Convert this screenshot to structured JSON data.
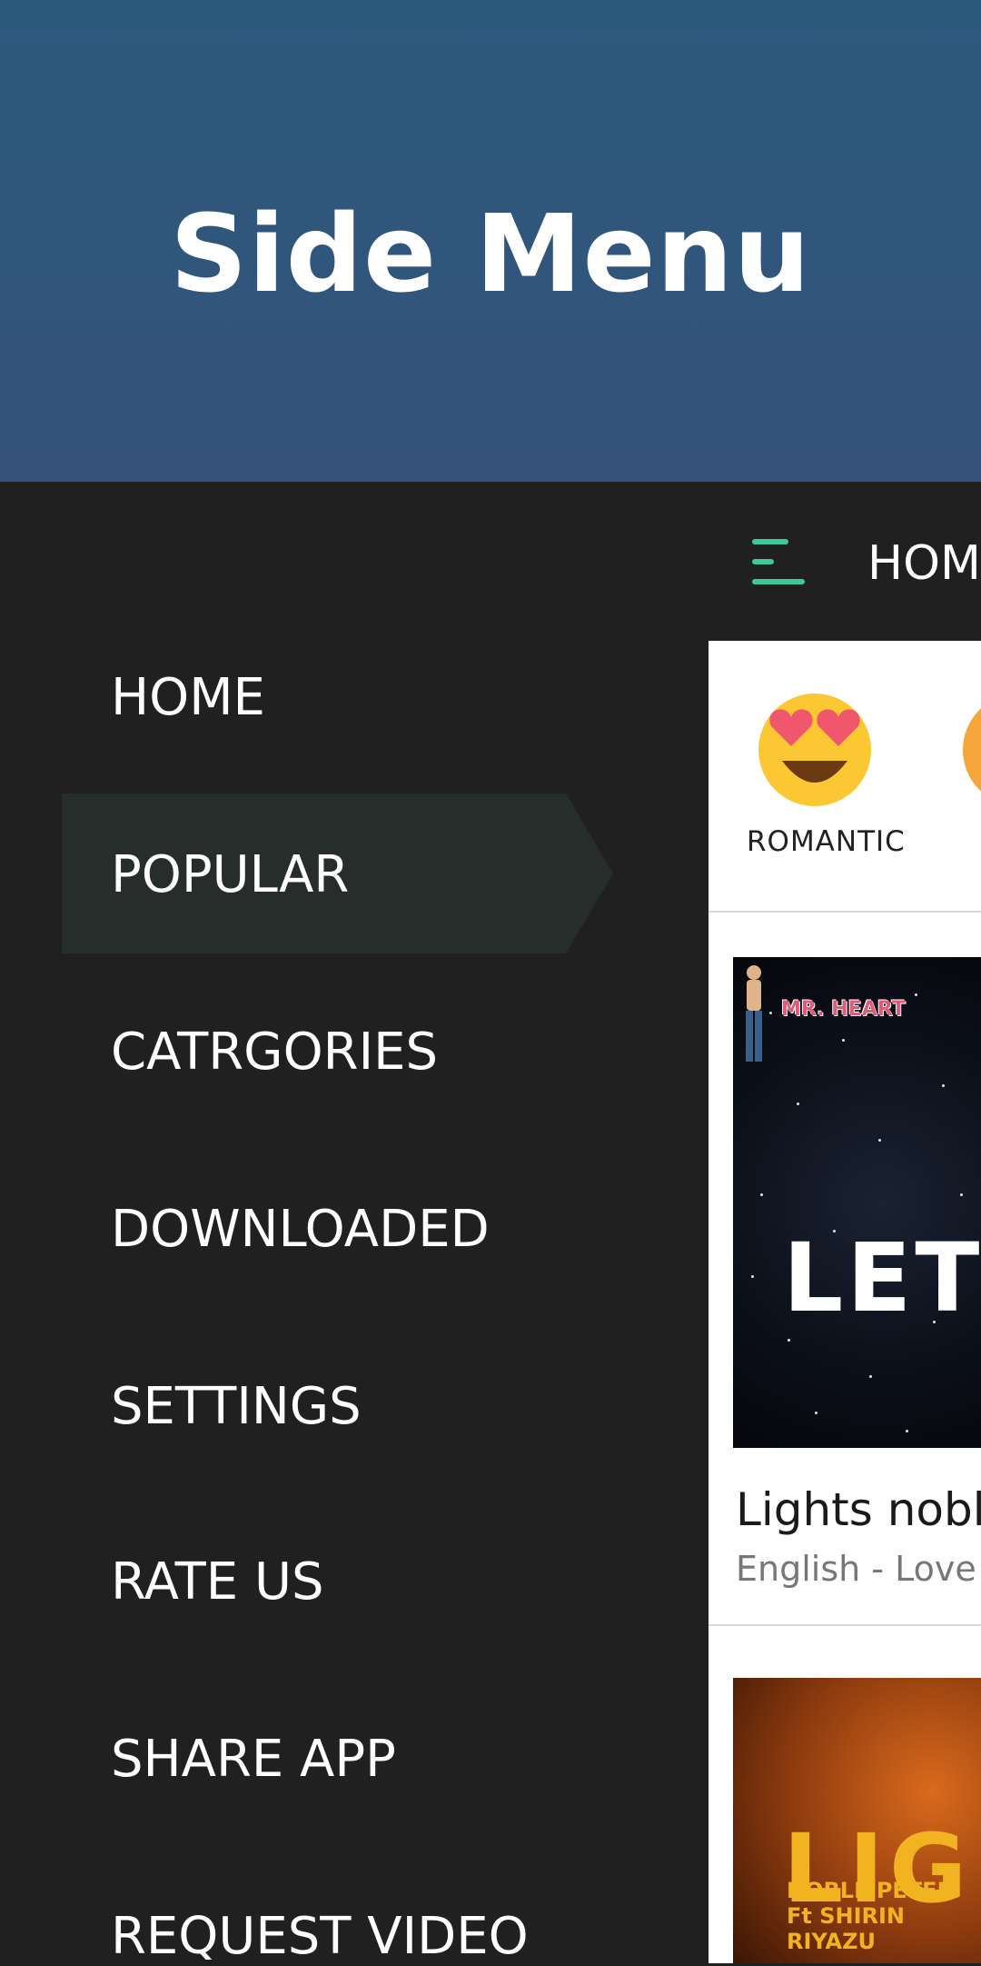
{
  "header": {
    "title": "Side Menu"
  },
  "menu": {
    "items": [
      {
        "label": "HOME"
      },
      {
        "label": "POPULAR",
        "active": true
      },
      {
        "label": "CATRGORIES"
      },
      {
        "label": "DOWNLOADED"
      },
      {
        "label": "SETTINGS"
      },
      {
        "label": "RATE US"
      },
      {
        "label": "SHARE APP"
      },
      {
        "label": "REQUEST VIDEO"
      }
    ]
  },
  "main": {
    "topbar": {
      "title": "HOME",
      "menu_icon": "hamburger-icon",
      "accent": "#3ec89b"
    },
    "categories": [
      {
        "label": "ROMANTIC",
        "icon": "heart-eyes-emoji-icon"
      }
    ],
    "videos": [
      {
        "thumbnail_text": "LET",
        "logo_text": "MR. HEART",
        "title": "Lights nobl",
        "subtitle": "English - Love F"
      },
      {
        "thumbnail_text": "LIG",
        "thumbnail_sub": "NOBLE PETER\nFt SHIRIN RIYAZU"
      }
    ]
  },
  "colors": {
    "header_bg": "#2f577b",
    "drawer_bg": "#202020",
    "active_item_bg": "#272d2b",
    "text": "#ffffff"
  }
}
